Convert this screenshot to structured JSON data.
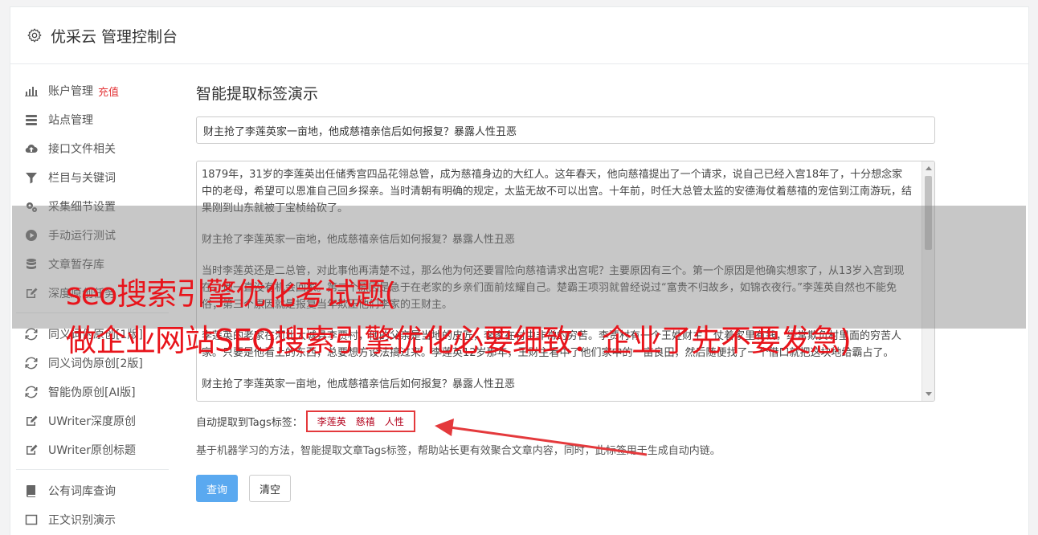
{
  "header": {
    "title": "优采云 管理控制台",
    "icon": "gear-icon"
  },
  "sidebar": {
    "items": [
      {
        "label": "账户管理",
        "icon": "bar-chart-icon",
        "badge": "充值"
      },
      {
        "label": "站点管理",
        "icon": "server-icon"
      },
      {
        "label": "接口文件相关",
        "icon": "cloud-upload-icon"
      },
      {
        "label": "栏目与关键词",
        "icon": "filter-icon"
      },
      {
        "label": "采集细节设置",
        "icon": "cogs-icon"
      },
      {
        "label": "手动运行测试",
        "icon": "play-circle-icon"
      },
      {
        "label": "文章暂存库",
        "icon": "database-icon"
      },
      {
        "label": "深度原创任务",
        "icon": "edit-icon"
      }
    ],
    "items2": [
      {
        "label": "同义词伪原创[1版]",
        "icon": "refresh-icon"
      },
      {
        "label": "同义词伪原创[2版]",
        "icon": "refresh-icon"
      },
      {
        "label": "智能伪原创[AI版]",
        "icon": "refresh-icon"
      },
      {
        "label": "UWriter深度原创",
        "icon": "edit-icon"
      },
      {
        "label": "UWriter原创标题",
        "icon": "edit-icon"
      }
    ],
    "items3": [
      {
        "label": "公有词库查询",
        "icon": "book-icon"
      },
      {
        "label": "正文识别演示",
        "icon": "square-icon"
      }
    ]
  },
  "main": {
    "title": "智能提取标签演示",
    "title_input_value": "财主抢了李莲英家一亩地，他成慈禧亲信后如何报复？暴露人性丑恶",
    "paragraphs": [
      "1879年，31岁的李莲英出任储秀宫四品花翎总管，成为慈禧身边的大红人。这年春天，他向慈禧提出了一个请求，说自己已经入宫18年了，十分想念家中的老母，希望可以恩准自己回乡探亲。当时清朝有明确的规定，太监无故不可以出宫。十年前，时任大总管太监的安德海仗着慈禧的宠信到江南游玩，结果刚到山东就被丁宝桢给砍了。",
      "财主抢了李莲英家一亩地，他成慈禧亲信后如何报复？暴露人性丑恶",
      "当时李莲英还是二总管，对此事他再清楚不过，那么他为何还要冒险向慈禧请求出宫呢？主要原因有三个。第一个原因是他确实想家了，从13岁入宫到现在，他一直没有机会回家。第二个原因是急于在老家的乡亲们面前炫耀自己。楚霸王项羽就曾经说过“富贵不归故乡，如锦衣夜行。”李莲英自然也不能免俗；第三个原因就是报复当年欺压他们李家的王财主。",
      "李莲英的老家在河北大城县李贾村，他的父亲是当地的皮匠，李家在村中非常的穷苦。李贾村有一个王姓财主，仗着家里有钱，经常欺负村里面的穷苦人家。只要是他看上的东西，总要想方设法搞过来。李莲英12岁那年，王财主看中了他们家中的一亩良田，然后随便找了一个借口就把这块地给霸占了。",
      "财主抢了李莲英家一亩地，他成慈禧亲信后如何报复？暴露人性丑恶"
    ],
    "tags_label": "自动提取到Tags标签：",
    "tags": [
      "李莲英",
      "慈禧",
      "人性"
    ],
    "description": "基于机器学习的方法，智能提取文章Tags标签，帮助站长更有效聚合文章内容，同时，此标签用于生成自动内链。",
    "query_button": "查询",
    "clear_button": "清空"
  },
  "overlay": {
    "line1": "seo搜索引擎优化考试题(",
    "line2": "做企业网站SEO搜索引擎优化必要细致：企业了先不要发急)"
  },
  "colors": {
    "accent": "#5aa9f0",
    "highlight_red": "#e4393c",
    "overlay_text": "#e8141b"
  }
}
